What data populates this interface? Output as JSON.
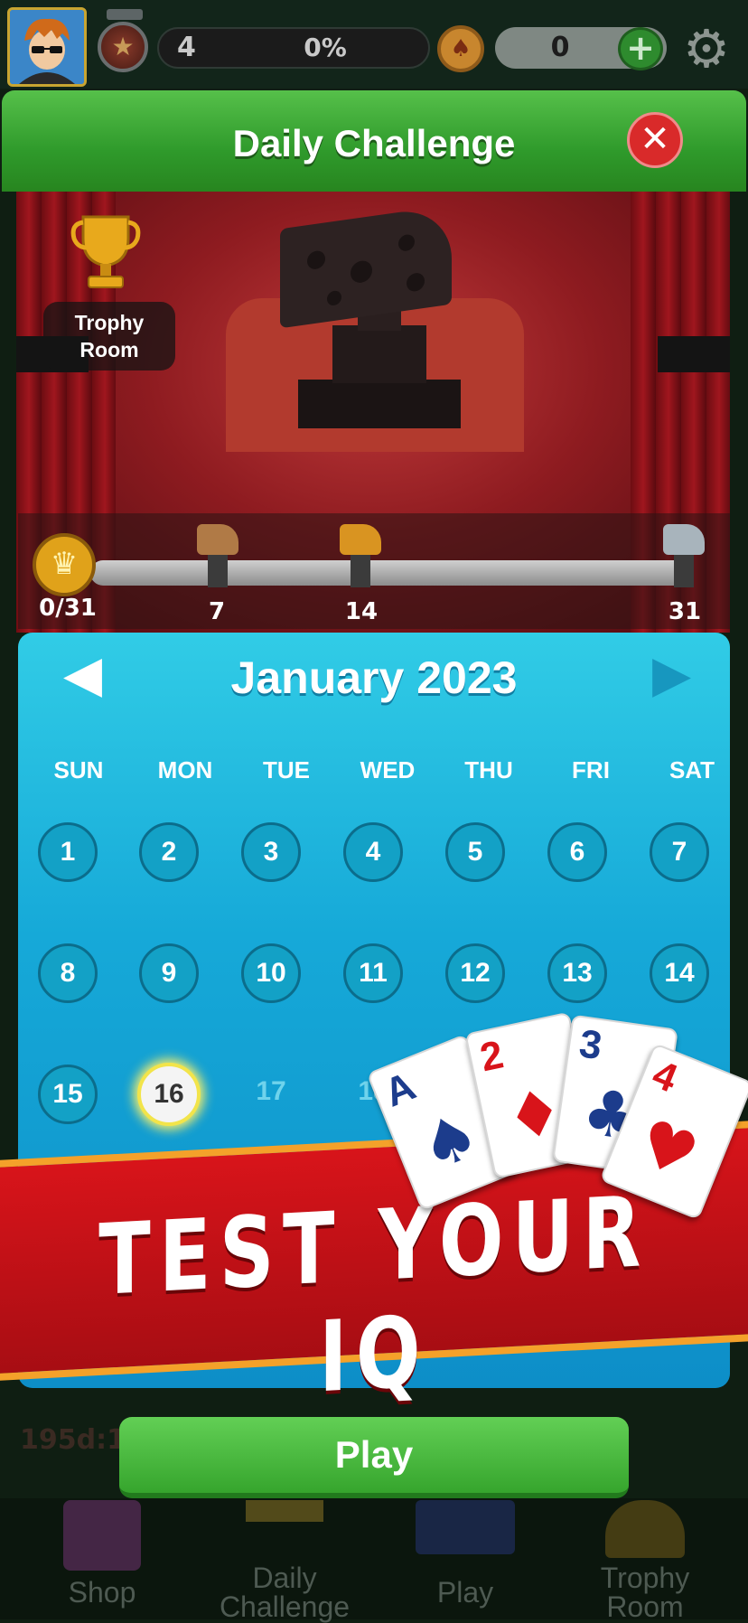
{
  "topbar": {
    "level": "4",
    "level_progress": "0%",
    "coins": "0",
    "plus_label": "+",
    "settings_icon": "gear-icon"
  },
  "header": {
    "title": "Daily Challenge",
    "close_label": "✕"
  },
  "stage": {
    "trophy_room_label": "Trophy Room",
    "progress_count": "0/31",
    "milestones": [
      "7",
      "14",
      "31"
    ]
  },
  "calendar": {
    "month": "January 2023",
    "weekdays": [
      "SUN",
      "MON",
      "TUE",
      "WED",
      "THU",
      "FRI",
      "SAT"
    ],
    "days": [
      "1",
      "2",
      "3",
      "4",
      "5",
      "6",
      "7",
      "8",
      "9",
      "10",
      "11",
      "12",
      "13",
      "14",
      "15",
      "16",
      "17",
      "18"
    ],
    "today": "16"
  },
  "banner": {
    "text": "TEST YOUR IQ",
    "cards": [
      {
        "rank": "A",
        "suit": "♠",
        "color": "#1c3c8c"
      },
      {
        "rank": "2",
        "suit": "♦",
        "color": "#d8141a"
      },
      {
        "rank": "3",
        "suit": "♣",
        "color": "#1c3c8c"
      },
      {
        "rank": "4",
        "suit": "♥",
        "color": "#d8141a"
      }
    ]
  },
  "bottom": {
    "countdown": "195d:14",
    "play_label": "Play"
  },
  "navbar": {
    "shop": "Shop",
    "daily_line1": "Daily",
    "daily_line2": "Challenge",
    "play": "Play",
    "trophy_line1": "Trophy",
    "trophy_line2": "Room"
  }
}
